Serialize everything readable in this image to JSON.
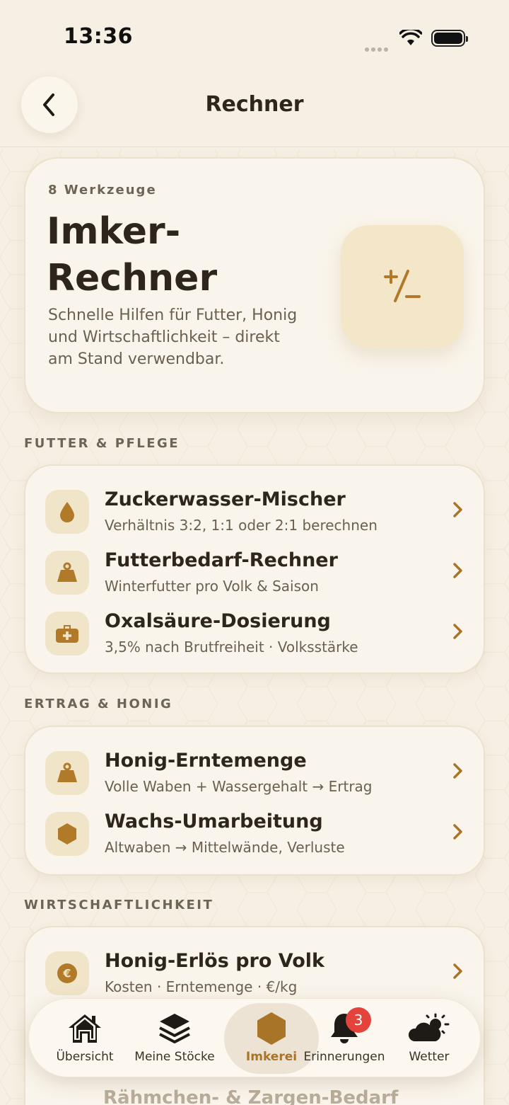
{
  "status": {
    "time": "13:36"
  },
  "header": {
    "title": "Rechner"
  },
  "hero": {
    "count": "8 Werkzeuge",
    "title_line1": "Imker-",
    "title_line2": "Rechner",
    "description": "Schnelle Hilfen für Futter, Honig und Wirtschaftlichkeit – direkt am Stand verwendbar."
  },
  "sections": [
    {
      "label": "FUTTER & PFLEGE",
      "items": [
        {
          "title": "Zuckerwasser-Mischer",
          "subtitle": "Verhältnis 3:2, 1:1 oder 2:1 berechnen",
          "icon": "drop-icon"
        },
        {
          "title": "Futterbedarf-Rechner",
          "subtitle": "Winterfutter pro Volk & Saison",
          "icon": "weight-icon"
        },
        {
          "title": "Oxalsäure-Dosierung",
          "subtitle": "3,5% nach Brutfreiheit · Volksstärke",
          "icon": "medkit-icon"
        }
      ]
    },
    {
      "label": "ERTRAG & HONIG",
      "items": [
        {
          "title": "Honig-Erntemenge",
          "subtitle": "Volle Waben + Wassergehalt → Ertrag",
          "icon": "weight-icon"
        },
        {
          "title": "Wachs-Umarbeitung",
          "subtitle": "Altwaben → Mittelwände, Verluste",
          "icon": "hexagon-icon"
        }
      ]
    },
    {
      "label": "WIRTSCHAFTLICHKEIT",
      "items": [
        {
          "title": "Honig-Erlös pro Volk",
          "subtitle": "Kosten · Erntemenge · €/kg",
          "icon": "euro-icon"
        }
      ]
    }
  ],
  "partial_item": "Rähmchen- & Zargen-Bedarf",
  "tabs": [
    {
      "label": "Übersicht",
      "icon": "home-icon"
    },
    {
      "label": "Meine Stöcke",
      "icon": "layers-icon"
    },
    {
      "label": "Imkerei",
      "icon": "hexagon-icon",
      "active": true
    },
    {
      "label": "Erinnerungen",
      "icon": "bell-icon",
      "badge": "3"
    },
    {
      "label": "Wetter",
      "icon": "weather-icon"
    }
  ],
  "colors": {
    "accent": "#a87428",
    "background": "#f6efe3",
    "badge": "#e4433c"
  }
}
